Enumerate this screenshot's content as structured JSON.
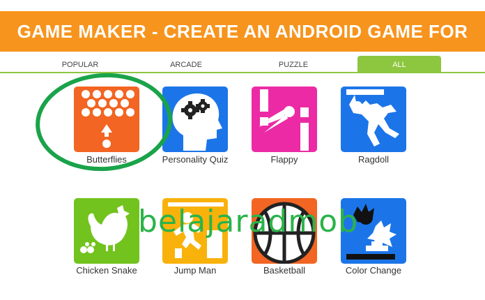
{
  "header": {
    "title": "GAME MAKER - CREATE AN ANDROID GAME FOR FREE!"
  },
  "tabs": [
    {
      "label": "POPULAR",
      "active": false
    },
    {
      "label": "ARCADE",
      "active": false
    },
    {
      "label": "PUZZLE",
      "active": false
    },
    {
      "label": "ALL",
      "active": true
    }
  ],
  "games": [
    {
      "name": "Butterflies",
      "color": "#f26522",
      "icon": "bubble-shooter-icon"
    },
    {
      "name": "Personality Quiz",
      "color": "#1c75e8",
      "icon": "head-gears-icon"
    },
    {
      "name": "Flappy",
      "color": "#ec2aa5",
      "icon": "comet-pipes-icon"
    },
    {
      "name": "Ragdoll",
      "color": "#1c75e8",
      "icon": "falling-man-icon"
    },
    {
      "name": "Chicken Snake",
      "color": "#72c31e",
      "icon": "chicken-icon"
    },
    {
      "name": "Jump Man",
      "color": "#f9b20b",
      "icon": "jumping-man-icon"
    },
    {
      "name": "Basketball",
      "color": "#f26522",
      "icon": "basketball-icon"
    },
    {
      "name": "Color Change",
      "color": "#1c75e8",
      "icon": "color-change-icon"
    }
  ],
  "watermark": {
    "text": "belajaradmob"
  },
  "highlight": {
    "color": "#1aa34a"
  }
}
